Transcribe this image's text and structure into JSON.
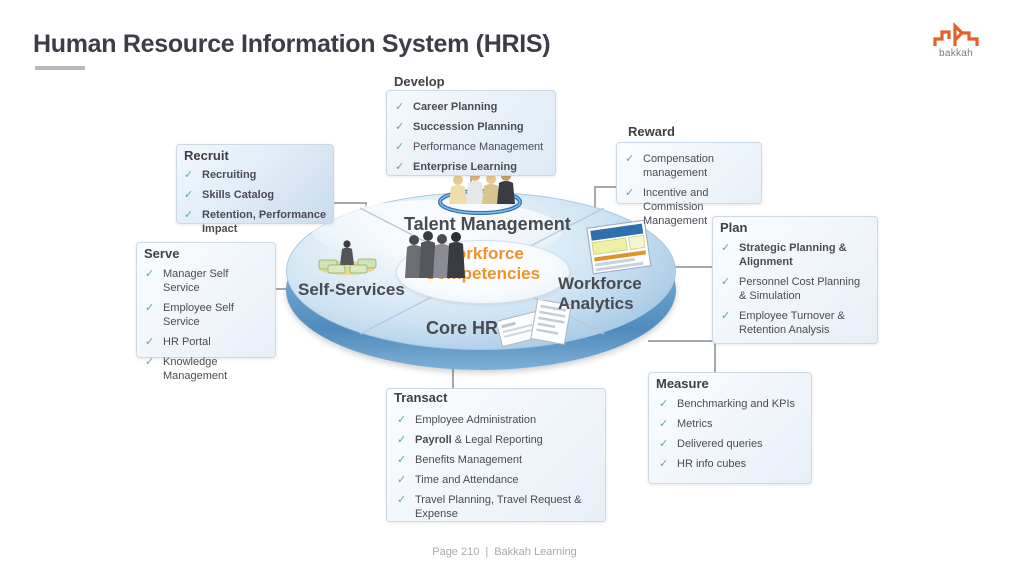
{
  "header": {
    "title": "Human Resource Information System (HRIS)",
    "logo_text": "bakkah",
    "logo_icon": "bakkah-logo-icon",
    "logo_color": "#e2622c"
  },
  "center": {
    "core_label_line1": "Workforce",
    "core_label_line2": "Competencies",
    "core_color": "#f0922b",
    "quadrants": [
      {
        "name": "talent-management",
        "label": "Talent  Management",
        "icon": "people-group-icon"
      },
      {
        "name": "workforce-analytics",
        "label": "Workforce Analytics",
        "icon": "report-chart-icon"
      },
      {
        "name": "core-hr",
        "label": "Core HR",
        "icon": "documents-icon"
      },
      {
        "name": "self-services",
        "label": "Self-Services",
        "icon": "money-person-icon"
      }
    ]
  },
  "boxes": [
    {
      "name": "develop",
      "title": "Develop",
      "items": [
        {
          "text": "Career Planning",
          "bold": true
        },
        {
          "text": "Succession Planning",
          "bold": true
        },
        {
          "text": "Performance Management",
          "bold": false
        },
        {
          "text": "Enterprise Learning",
          "bold": true
        }
      ]
    },
    {
      "name": "recruit",
      "title": "Recruit",
      "items": [
        {
          "text": "Recruiting",
          "bold": true
        },
        {
          "text": "Skills Catalog",
          "bold": true
        },
        {
          "text": "Retention, Performance Impact",
          "bold": true
        }
      ]
    },
    {
      "name": "reward",
      "title": "Reward",
      "items": [
        {
          "text": "Compensation management",
          "bold": false
        },
        {
          "text": "Incentive and Commission Management",
          "bold": false
        }
      ]
    },
    {
      "name": "plan",
      "title": "Plan",
      "items": [
        {
          "text": "Strategic Planning & Alignment",
          "bold": true
        },
        {
          "text": "Personnel Cost Planning & Simulation",
          "bold": false
        },
        {
          "text": "Employee Turnover & Retention Analysis",
          "bold": false
        }
      ]
    },
    {
      "name": "serve",
      "title": "Serve",
      "items": [
        {
          "text": "Manager Self Service",
          "bold": false
        },
        {
          "text": "Employee Self Service",
          "bold": false
        },
        {
          "text": "HR Portal",
          "bold": false
        },
        {
          "text": "Knowledge Management",
          "bold": false
        }
      ]
    },
    {
      "name": "transact",
      "title": "Transact",
      "items": [
        {
          "text": "Employee Administration",
          "bold": false
        },
        {
          "text": "Payroll & Legal Reporting",
          "bold": false,
          "bold_prefix": "Payroll",
          "rest": " & Legal Reporting"
        },
        {
          "text": "Benefits Management",
          "bold": false
        },
        {
          "text": "Time and Attendance",
          "bold": false
        },
        {
          "text": "Travel Planning, Travel Request & Expense",
          "bold": false
        }
      ]
    },
    {
      "name": "measure",
      "title": "Measure",
      "items": [
        {
          "text": "Benchmarking and KPIs",
          "bold": false
        },
        {
          "text": "Metrics",
          "bold": false
        },
        {
          "text": "Delivered queries",
          "bold": false
        },
        {
          "text": "HR info cubes",
          "bold": false
        }
      ]
    }
  ],
  "footer": {
    "page": "Page 210",
    "separator": "|",
    "source": "Bakkah Learning"
  },
  "checkmark_glyph": "✓"
}
